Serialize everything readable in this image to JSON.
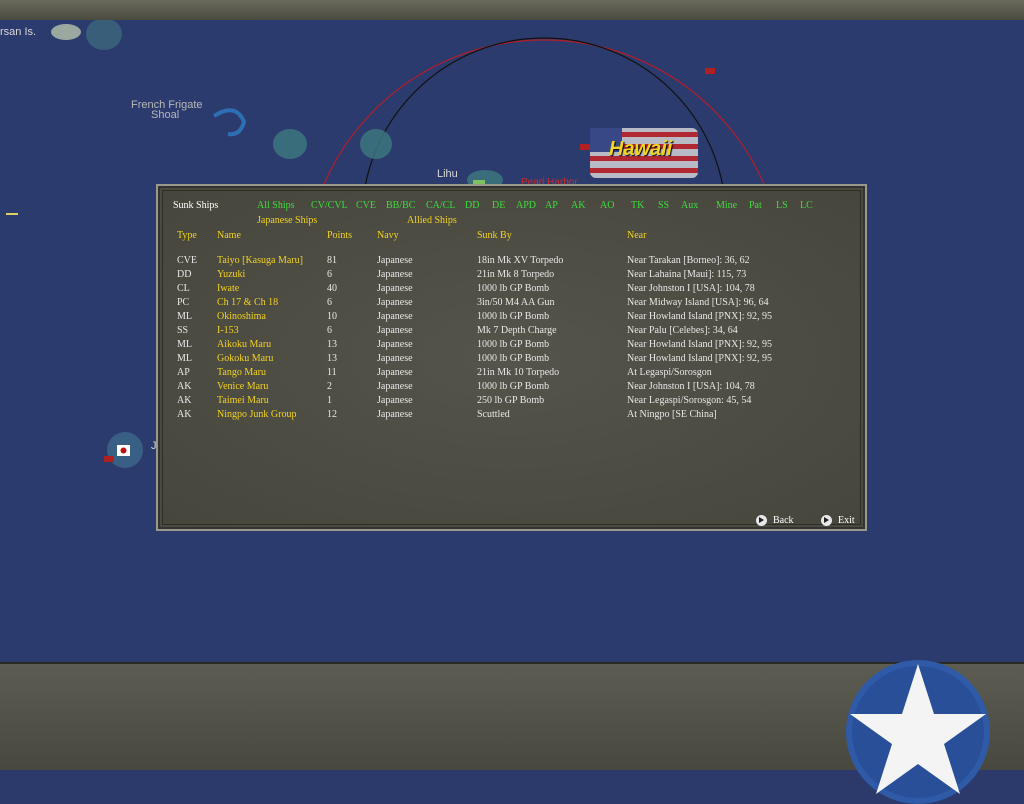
{
  "map": {
    "labels": {
      "larsan": "rsan Is.",
      "french_frigate": "French Frigate",
      "french_frigate_2": "Shoal",
      "lihu": "Lihu",
      "hawaii": "Hawaii",
      "pearl": "Pearl Harbor",
      "j_label": "J"
    }
  },
  "dialog": {
    "title": "Sunk Ships",
    "filters_row1": [
      "All Ships",
      "CV/CVL",
      "CVE",
      "BB/BC",
      "CA/CL",
      "DD",
      "DE",
      "APD",
      "AP",
      "AK",
      "AO",
      "TK",
      "SS",
      "Aux",
      "Mine",
      "Pat",
      "LS",
      "LC"
    ],
    "filters_row2": [
      "Japanese Ships",
      "Allied Ships"
    ],
    "columns": [
      "Type",
      "Name",
      "Points",
      "Navy",
      "Sunk By",
      "Near"
    ],
    "rows": [
      [
        "CVE",
        "Taiyo [Kasuga Maru]",
        "81",
        "Japanese",
        "18in Mk XV Torpedo",
        "Near Tarakan [Borneo]: 36, 62"
      ],
      [
        "DD",
        "Yuzuki",
        "6",
        "Japanese",
        "21in Mk 8 Torpedo",
        "Near Lahaina [Maui]: 115, 73"
      ],
      [
        "CL",
        "Iwate",
        "40",
        "Japanese",
        "1000 lb GP Bomb",
        "Near Johnston I [USA]: 104, 78"
      ],
      [
        "PC",
        "Ch 17 & Ch 18",
        "6",
        "Japanese",
        "3in/50 M4 AA Gun",
        "Near Midway Island [USA]: 96, 64"
      ],
      [
        "ML",
        "Okinoshima",
        "10",
        "Japanese",
        "1000 lb GP Bomb",
        "Near Howland Island [PNX]: 92, 95"
      ],
      [
        "SS",
        "I-153",
        "6",
        "Japanese",
        "Mk 7 Depth Charge",
        "Near Palu [Celebes]: 34, 64"
      ],
      [
        "ML",
        "Aikoku Maru",
        "13",
        "Japanese",
        "1000 lb GP Bomb",
        "Near Howland Island [PNX]: 92, 95"
      ],
      [
        "ML",
        "Gokoku Maru",
        "13",
        "Japanese",
        "1000 lb GP Bomb",
        "Near Howland Island [PNX]: 92, 95"
      ],
      [
        "AP",
        "Tango Maru",
        "11",
        "Japanese",
        "21in Mk 10 Torpedo",
        "At Legaspi/Sorosgon"
      ],
      [
        "AK",
        "Venice Maru",
        "2",
        "Japanese",
        "1000 lb GP Bomb",
        "Near Johnston I [USA]: 104, 78"
      ],
      [
        "AK",
        "Taimei Maru",
        "1",
        "Japanese",
        "250 lb GP Bomb",
        "Near Legaspi/Sorosgon: 45, 54"
      ],
      [
        "AK",
        "Ningpo Junk Group",
        "12",
        "Japanese",
        "Scuttled",
        "At Ningpo [SE China]"
      ]
    ],
    "back_label": "Back",
    "exit_label": "Exit"
  },
  "colors": {
    "filter": "#3ddc3d",
    "header": "#f2d321",
    "ocean": "#2c3b6d"
  }
}
